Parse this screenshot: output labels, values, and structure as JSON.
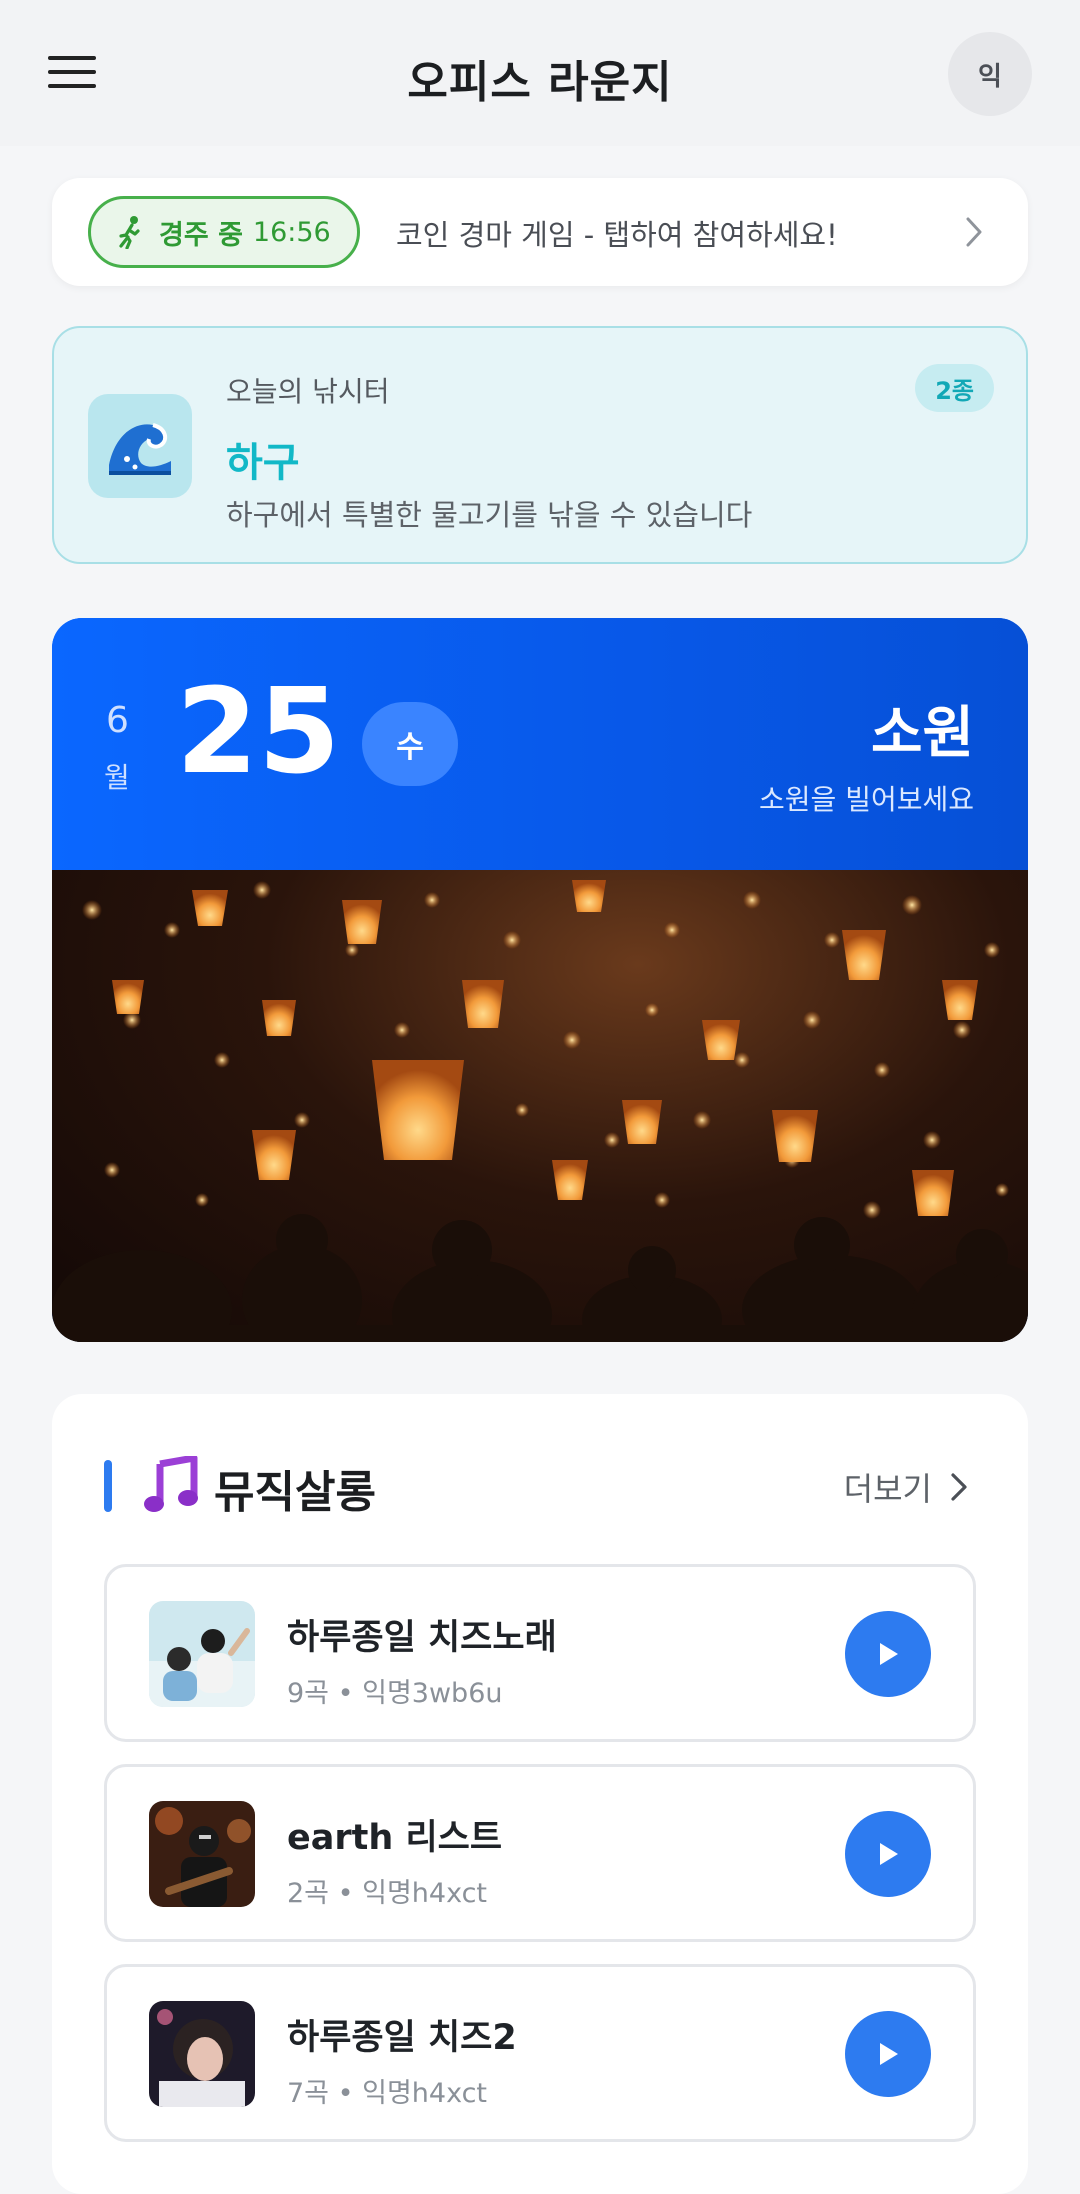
{
  "header": {
    "title": "오피스 라운지",
    "avatar_text": "익",
    "menu_icon": "hamburger-menu-icon"
  },
  "race": {
    "status": "경주 중",
    "time": "16:56",
    "message": "코인 경마 게임 - 탭하여 참여하세요!",
    "icon": "runner-icon",
    "accent": "#47b04b"
  },
  "fishing": {
    "label": "오늘의 낚시터",
    "spot": "하구",
    "description": "하구에서 특별한 물고기를 낚을 수 있습니다",
    "badge": "2종",
    "icon": "wave-icon",
    "accent": "#11b8c7"
  },
  "calendar": {
    "month": "6",
    "month_unit": "월",
    "day": "25",
    "weekday": "수",
    "title": "소원",
    "subtitle": "소원을 빌어보세요",
    "accent": "#0a67ff"
  },
  "music": {
    "title": "뮤직살롱",
    "more_label": "더보기",
    "icon": "music-note-icon",
    "playlists": [
      {
        "name": "하루종일 치즈노래",
        "meta": "9곡 • 익명3wb6u"
      },
      {
        "name": "earth 리스트",
        "meta": "2곡 • 익명h4xct"
      },
      {
        "name": "하루종일 치즈2",
        "meta": "7곡 • 익명h4xct"
      }
    ],
    "accent": "#2d7bf0"
  }
}
